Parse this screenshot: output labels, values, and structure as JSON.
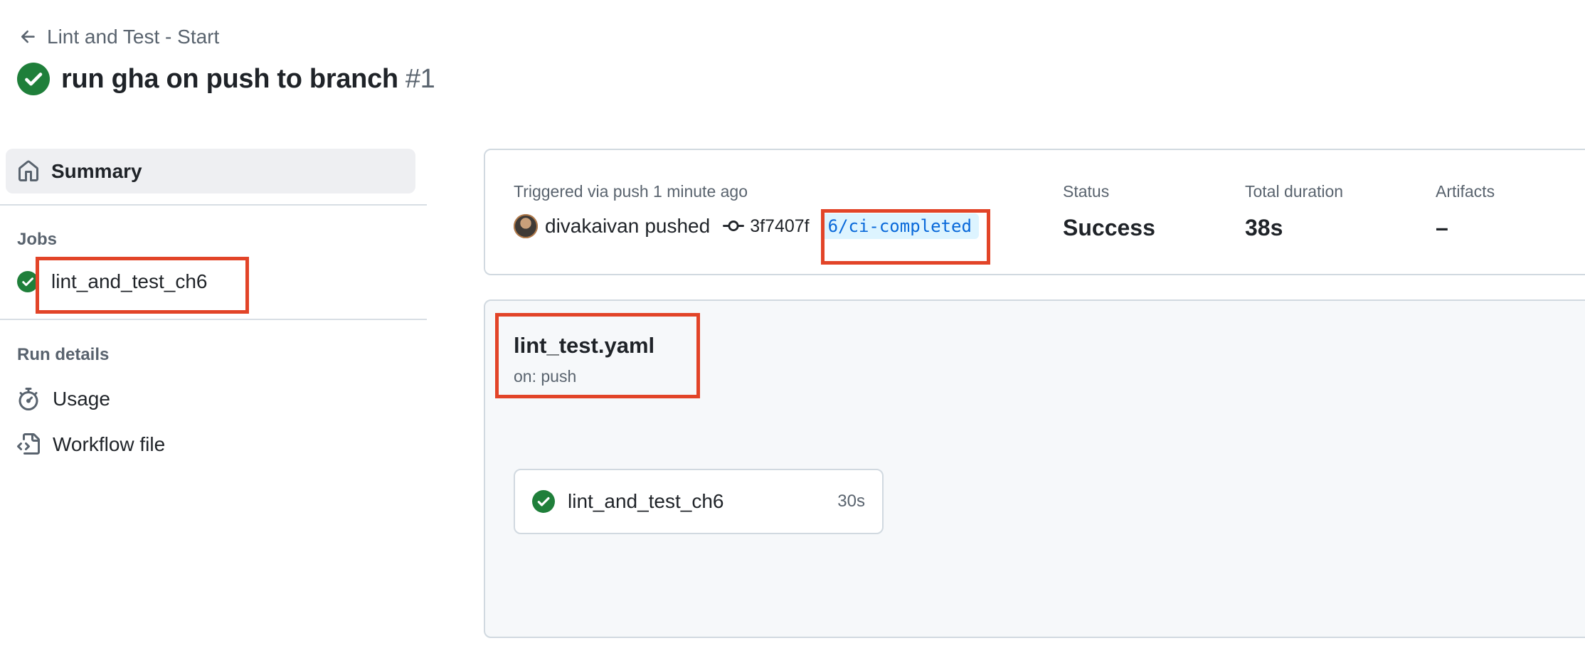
{
  "header": {
    "back_label": "Lint and Test - Start",
    "title": "run gha on push to branch",
    "run_number": "#1"
  },
  "sidebar": {
    "summary_label": "Summary",
    "jobs_title": "Jobs",
    "jobs": [
      {
        "label": "lint_and_test_ch6",
        "status": "success"
      }
    ],
    "run_details_title": "Run details",
    "run_details": [
      {
        "label": "Usage",
        "icon": "stopwatch-icon"
      },
      {
        "label": "Workflow file",
        "icon": "file-code-icon"
      }
    ]
  },
  "trigger": {
    "triggered_text": "Triggered via push 1 minute ago",
    "actor": "divakaivan",
    "action": "pushed",
    "commit_sha": "3f7407f",
    "branch": "6/ci-completed"
  },
  "stats": {
    "status_label": "Status",
    "status_value": "Success",
    "duration_label": "Total duration",
    "duration_value": "38s",
    "artifacts_label": "Artifacts",
    "artifacts_value": "–"
  },
  "workflow": {
    "file_name": "lint_test.yaml",
    "trigger": "on: push",
    "jobs": [
      {
        "name": "lint_and_test_ch6",
        "duration": "30s",
        "status": "success"
      }
    ]
  },
  "colors": {
    "success": "#1a7f37",
    "highlight": "#e24428",
    "link": "#0969da"
  }
}
